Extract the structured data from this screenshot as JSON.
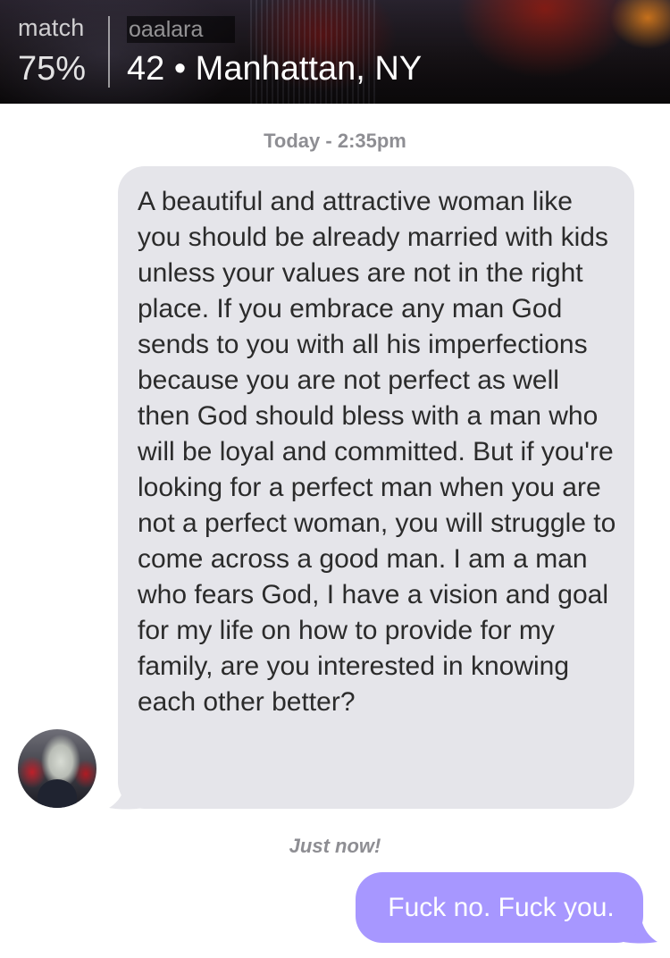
{
  "header": {
    "match_label": "match",
    "match_value": "75%",
    "username": "oaalara",
    "age": "42",
    "separator": "•",
    "location": "Manhattan, NY",
    "profile_info": "42 • Manhattan, NY"
  },
  "conversation": {
    "timestamp_first": "Today - 2:35pm",
    "incoming_message": "A beautiful and attractive woman like you should be already married with kids unless your values are not in the right place. If you embrace any man God sends to you with all his imperfections because you are not perfect as well then God should bless with a man who will be loyal and committed. But if you're looking for a perfect man when you are not a perfect woman, you will struggle to come across a good man. I am a man who fears God, I have a vision and goal for my life on how to provide for my family, are you interested in knowing each other better?",
    "timestamp_second": "Just now!",
    "outgoing_message": "Fuck no. Fuck you."
  },
  "colors": {
    "incoming_bubble": "#e5e5ea",
    "outgoing_bubble": "#a797ff",
    "timestamp_text": "#8e8e93",
    "incoming_text": "#2b2b2b",
    "outgoing_text": "#ffffff"
  },
  "icons": {
    "avatar": "sender-avatar-photo"
  }
}
